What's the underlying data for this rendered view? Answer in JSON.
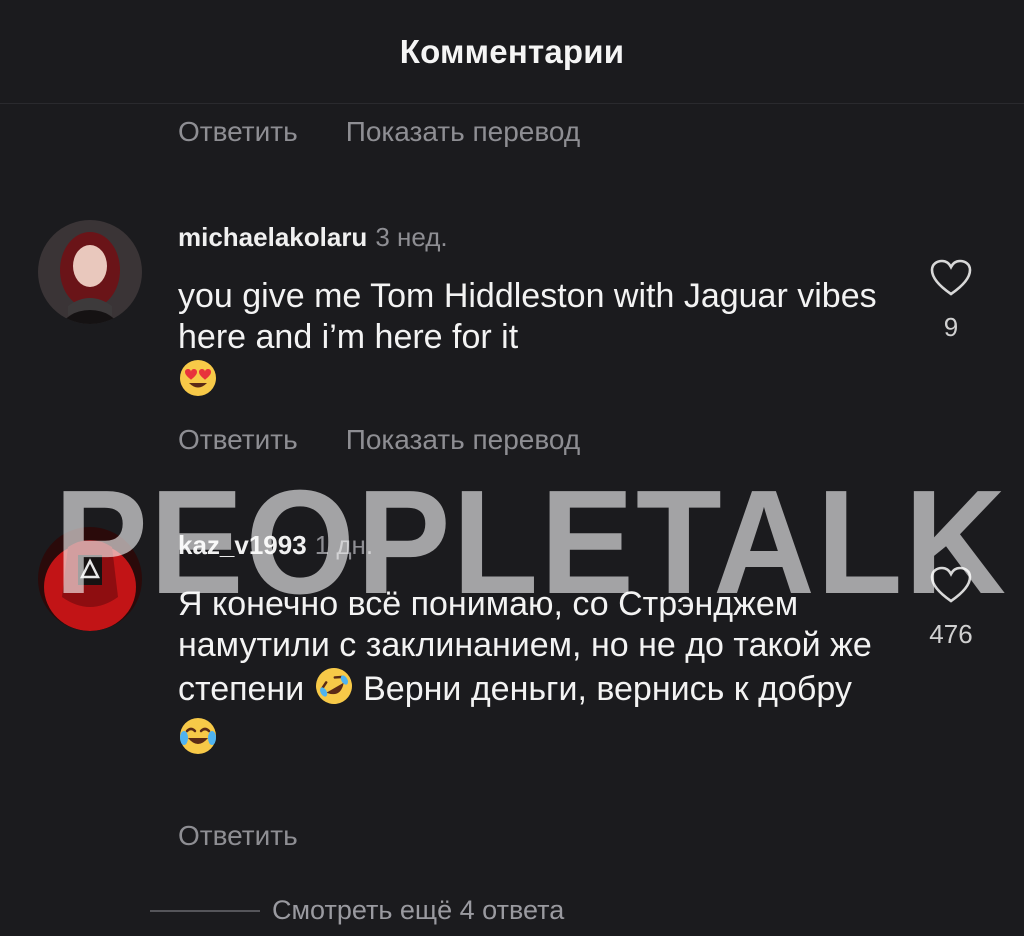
{
  "header": {
    "title": "Комментарии"
  },
  "top_actions": {
    "reply": "Ответить",
    "translate": "Показать перевод"
  },
  "comments": [
    {
      "username": "michaelakolaru",
      "time": "3 нед.",
      "text": "you give me Tom Hiddleston with Jaguar vibes here and i’m here for it",
      "emoji": "heart-eyes",
      "likes": "9",
      "reply": "Ответить",
      "translate": "Показать перевод"
    },
    {
      "username": "kaz_v1993",
      "time": "1 дн.",
      "text_part1": "Я конечно всё понимаю, со Стрэнджем намутили с заклинанием, но не до такой же степени",
      "text_part2": "Верни деньги, вернись к добру",
      "emoji1": "rolling-on-floor-laughing",
      "emoji2": "tears-of-joy",
      "likes": "476",
      "reply": "Ответить"
    }
  ],
  "watermark": "PEOPLETALK",
  "view_more": "Смотреть ещё 4 ответа",
  "colors": {
    "background": "#1b1b1e",
    "secondary_text": "#8e8e93",
    "primary_text": "#f3f3f3"
  }
}
